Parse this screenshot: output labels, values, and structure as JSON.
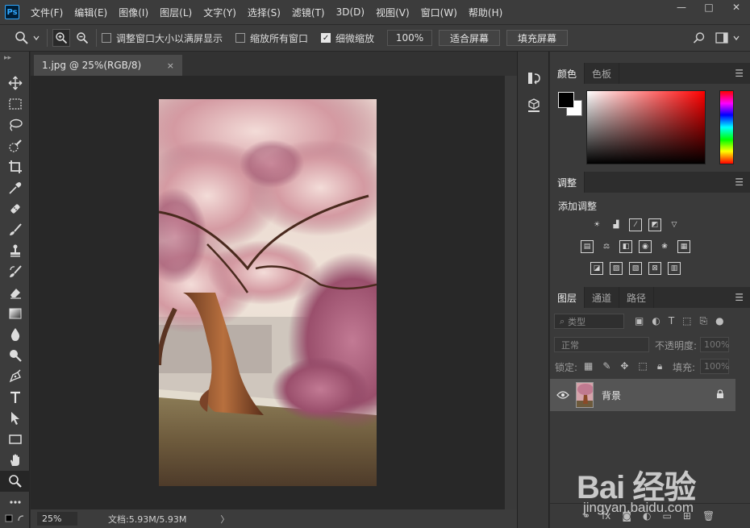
{
  "app": {
    "logo": "Ps"
  },
  "menu": [
    "文件(F)",
    "编辑(E)",
    "图像(I)",
    "图层(L)",
    "文字(Y)",
    "选择(S)",
    "滤镜(T)",
    "3D(D)",
    "视图(V)",
    "窗口(W)",
    "帮助(H)"
  ],
  "window_controls": {
    "minimize": "—",
    "restore": "□",
    "close": "✕"
  },
  "options": {
    "resize_windows_label": "调整窗口大小以满屏显示",
    "resize_windows_checked": false,
    "zoom_all_label": "缩放所有窗口",
    "zoom_all_checked": false,
    "scrubby_zoom_label": "细微缩放",
    "scrubby_zoom_checked": true,
    "zoom_value": "100%",
    "fit_screen_label": "适合屏幕",
    "fill_screen_label": "填充屏幕"
  },
  "document": {
    "tab_title": "1.jpg @ 25%(RGB/8)",
    "tab_close": "×",
    "status_zoom": "25%",
    "status_docinfo": "文档:5.93M/5.93M",
    "status_arrow": "〉"
  },
  "tools": [
    "move-tool",
    "rectangular-marquee-tool",
    "lasso-tool",
    "quick-selection-tool",
    "crop-tool",
    "eyedropper-tool",
    "spot-healing-brush-tool",
    "brush-tool",
    "clone-stamp-tool",
    "history-brush-tool",
    "eraser-tool",
    "gradient-tool",
    "blur-tool",
    "dodge-tool",
    "pen-tool",
    "type-tool",
    "path-selection-tool",
    "rectangle-tool",
    "hand-tool",
    "zoom-tool",
    "more-tools"
  ],
  "panels": {
    "color_tab": "颜色",
    "swatches_tab": "色板",
    "adjustments_tab": "调整",
    "add_adjustment": "添加调整",
    "layers_tab": "图层",
    "channels_tab": "通道",
    "paths_tab": "路径",
    "layer_filter": "类型",
    "blend_mode": "正常",
    "opacity_label": "不透明度:",
    "opacity_value": "100%",
    "lock_label": "锁定:",
    "fill_label": "填充:",
    "fill_value": "100%",
    "layer_name": "背景"
  },
  "colors": {
    "foreground": "#000000",
    "background": "#ffffff"
  },
  "watermark": {
    "text": "Bai 经验",
    "url": "jingyan.baidu.com"
  }
}
